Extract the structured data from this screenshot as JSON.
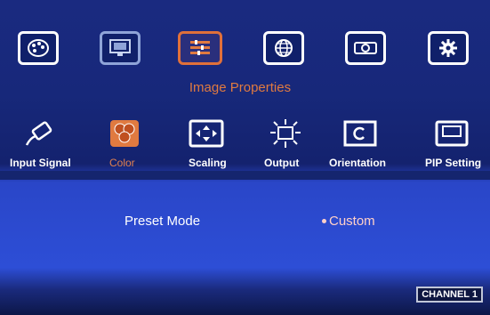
{
  "top_menu": {
    "items": [
      {
        "icon": "palette-icon"
      },
      {
        "icon": "monitor-icon"
      },
      {
        "icon": "image-properties-icon"
      },
      {
        "icon": "globe-icon"
      },
      {
        "icon": "projector-icon"
      },
      {
        "icon": "gear-icon"
      }
    ],
    "selected_title": "Image Properties"
  },
  "sub_menu": {
    "items": [
      {
        "label": "Input Signal",
        "icon": "plug-icon"
      },
      {
        "label": "Color",
        "icon": "rgb-color-icon"
      },
      {
        "label": "Scaling",
        "icon": "scaling-icon"
      },
      {
        "label": "Output",
        "icon": "output-sun-icon"
      },
      {
        "label": "Orientation",
        "icon": "orientation-icon"
      },
      {
        "label": "PIP Setting",
        "icon": "pip-icon"
      }
    ]
  },
  "content": {
    "preset_label": "Preset Mode",
    "preset_value": "Custom"
  },
  "footer": {
    "channel": "CHANNEL 1"
  },
  "colors": {
    "accent": "#e07a40",
    "selected_value": "#ffd0c8"
  }
}
